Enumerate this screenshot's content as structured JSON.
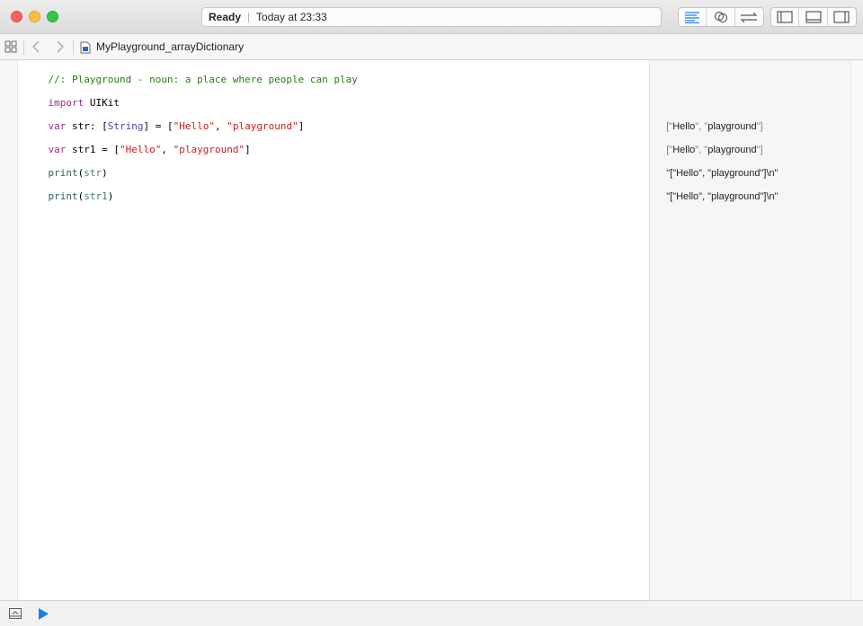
{
  "window": {
    "status": "Ready",
    "timestamp": "Today at 23:33",
    "colors": {
      "close": "#fc605c",
      "minimize": "#fdbc40",
      "maximize": "#34c84a",
      "accent": "#1f7cf0"
    }
  },
  "toolbar": {
    "editor_modes": [
      "standard-editor-icon",
      "assistant-editor-icon",
      "version-editor-icon"
    ],
    "view_toggles": [
      "navigator-panel-icon",
      "debug-area-panel-icon",
      "utilities-panel-icon"
    ]
  },
  "jumpbar": {
    "file_name": "MyPlayground_arrayDictionary"
  },
  "code": {
    "line1": {
      "text": "//: Playground - noun: a place where people can play"
    },
    "line2": {
      "kw": "import",
      "rest": " UIKit"
    },
    "line3": {
      "kw": "var",
      "a": " str: [",
      "type": "String",
      "b": "] = [",
      "s1": "\"Hello\"",
      "c": ", ",
      "s2": "\"playground\"",
      "d": "]"
    },
    "line4": {
      "kw": "var",
      "a": " str1 = [",
      "s1": "\"Hello\"",
      "c": ", ",
      "s2": "\"playground\"",
      "d": "]"
    },
    "line5": {
      "fn": "print",
      "a": "(",
      "var": "str",
      "b": ")"
    },
    "line6": {
      "fn": "print",
      "a": "(",
      "var": "str1",
      "b": ")"
    }
  },
  "results": {
    "r1": {
      "open": "[",
      "q1": "\"",
      "v1": "Hello",
      "q2": "\", \"",
      "v2": "playground",
      "q3": "\"",
      "close": "]"
    },
    "r2": {
      "open": "[",
      "q1": "\"",
      "v1": "Hello",
      "q2": "\", \"",
      "v2": "playground",
      "q3": "\"",
      "close": "]"
    },
    "r3": {
      "text": "\"[\"Hello\", \"playground\"]\\n\""
    },
    "r4": {
      "text": "\"[\"Hello\", \"playground\"]\\n\""
    }
  },
  "bottombar": {
    "icons": [
      "hide-debug-area-icon",
      "run-playground-icon"
    ]
  }
}
